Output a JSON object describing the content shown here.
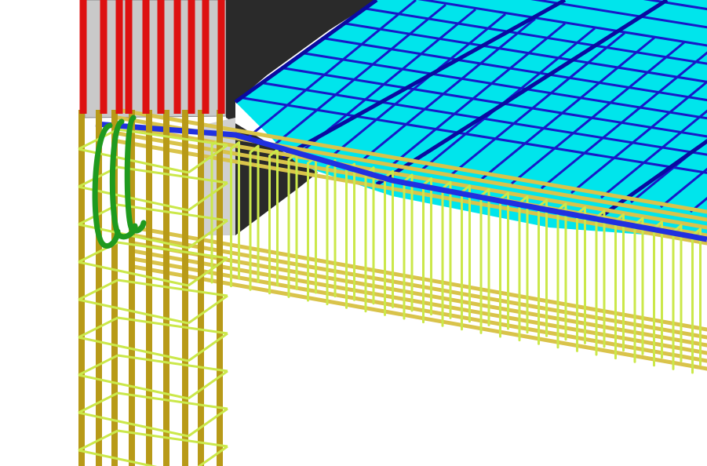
{
  "scene": {
    "subject": "3D rebar model",
    "colors": {
      "background": "#ffffff",
      "slab_fill": "#00e5ec",
      "slab_mesh": "#1818c8",
      "slab_mesh_heavy": "#0a0aa0",
      "slab_edge_bar": "#2030e0",
      "concrete_light": "#c4c4c4",
      "concrete_dark": "#2a2a2a",
      "column_vertical_bar": "#b89a18",
      "column_starter_bar": "#dd1111",
      "beam_longitudinal_bar": "#d9c34a",
      "stirrup": "#cbe84a",
      "hook_bar": "#1f9a1f"
    }
  }
}
